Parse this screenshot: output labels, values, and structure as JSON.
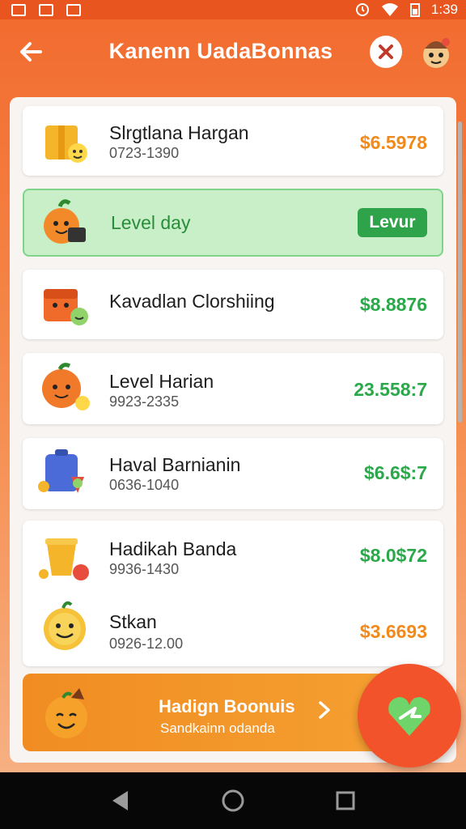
{
  "status_bar": {
    "time": "1:39"
  },
  "header": {
    "title": "Kanenn UadaBonnas",
    "back_icon": "arrow-left-icon",
    "close_icon": "close-icon"
  },
  "items": [
    {
      "title": "Slrgtlana Hargan",
      "subtitle": "0723-1390",
      "amount": "$6.5978",
      "amount_color": "#f08a1c"
    },
    {
      "title": "Level day",
      "button": "Levur"
    },
    {
      "title": "Kavadlan Clorshiing",
      "subtitle": "",
      "amount": "$8.8876",
      "amount_color": "#2aa84a"
    },
    {
      "title": "Level Harian",
      "subtitle": "9923-2335",
      "amount": "23.558:7",
      "amount_color": "#2aa84a"
    },
    {
      "title": "Haval Barnianin",
      "subtitle": "0636-1040",
      "amount": "$6.6$:7",
      "amount_color": "#2aa84a"
    },
    {
      "title": "Hadikah Banda",
      "subtitle": "9936-1430",
      "amount": "$8.0$72",
      "amount_color": "#2aa84a"
    },
    {
      "title": "Stkan",
      "subtitle": "0926-12.00",
      "amount": "$3.6693",
      "amount_color": "#f08a1c"
    }
  ],
  "bonus": {
    "title": "Hadign Boonuis",
    "subtitle": "Sandkainn odanda"
  },
  "colors": {
    "accent": "#f26a2e",
    "green": "#2fa34a",
    "orange_amount": "#f08a1c"
  }
}
